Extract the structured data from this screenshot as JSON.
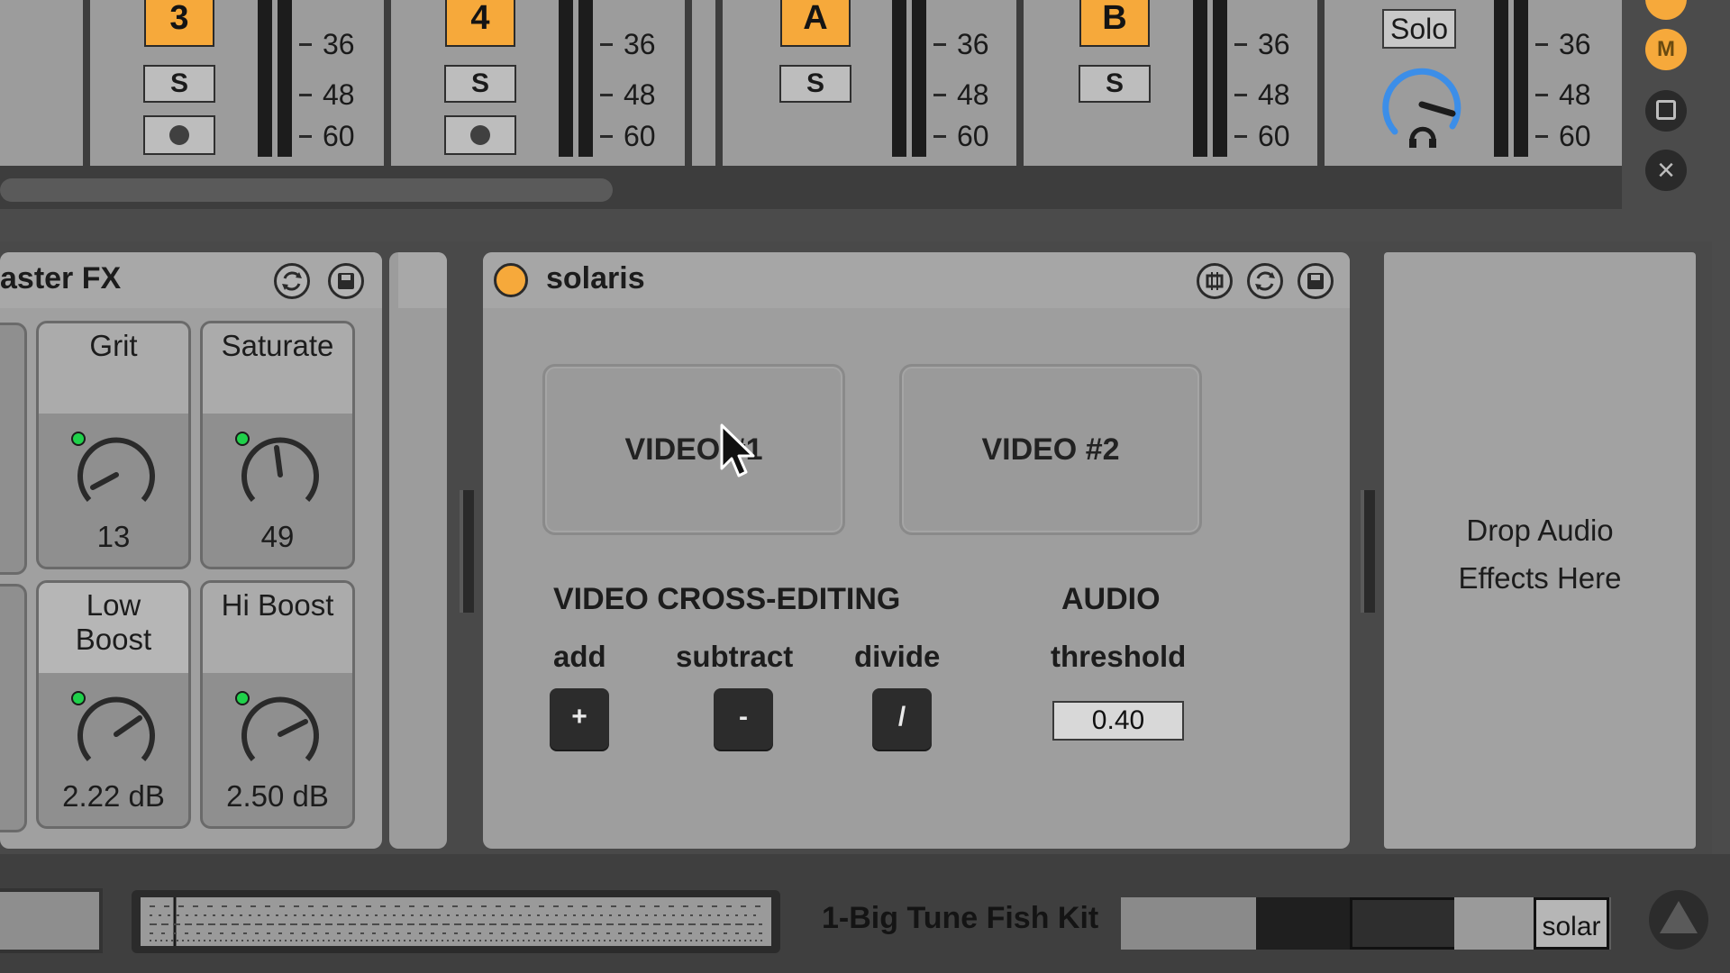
{
  "colors": {
    "accent_orange": "#f6a93b",
    "knob_ring": "#3c8ee8",
    "knob_indicator": "#1fd14a",
    "panel_bg": "#a0a0a0"
  },
  "mixer": {
    "track_top_scale": [
      "36",
      "48",
      "60"
    ],
    "tracks": [
      {
        "number": "3",
        "solo_label": "S",
        "has_arm": true
      },
      {
        "number": "4",
        "solo_label": "S",
        "has_arm": true
      },
      {
        "number": "A",
        "solo_label": "S",
        "has_arm": false
      },
      {
        "number": "B",
        "solo_label": "S",
        "has_arm": false
      }
    ],
    "master": {
      "solo_label": "Solo"
    },
    "side_buttons": {
      "mute": "M",
      "stop_icon": "stop-square-icon",
      "close": "×"
    }
  },
  "master_fx": {
    "title": "aster FX",
    "macros": [
      {
        "label": "Grit",
        "value": "13"
      },
      {
        "label": "Saturate",
        "value": "49"
      },
      {
        "label": "Low\nBoost",
        "value": "2.22 dB"
      },
      {
        "label": "Hi Boost",
        "value": "2.50 dB"
      }
    ]
  },
  "solaris": {
    "title": "solaris",
    "video1": "VIDEO #1",
    "video2": "VIDEO #2",
    "cross_editing_title": "VIDEO CROSS-EDITING",
    "ops": [
      {
        "label": "add",
        "symbol": "+"
      },
      {
        "label": "subtract",
        "symbol": "-"
      },
      {
        "label": "divide",
        "symbol": "/"
      }
    ],
    "audio_title": "AUDIO",
    "threshold_label": "threshold",
    "threshold_value": "0.40"
  },
  "drop_zone": {
    "line1": "Drop Audio",
    "line2": "Effects Here"
  },
  "bottom": {
    "kit_name": "1-Big Tune Fish Kit",
    "thumb_label": "solar"
  }
}
